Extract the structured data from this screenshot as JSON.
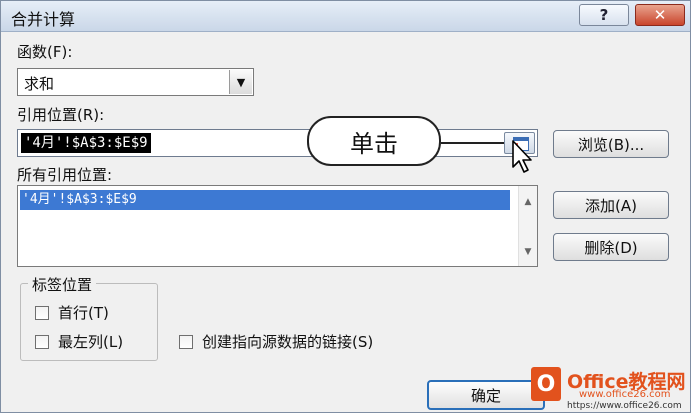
{
  "window": {
    "title": "合并计算",
    "help_label": "?",
    "close_label": "✕"
  },
  "function": {
    "label": "函数(F):",
    "selected": "求和"
  },
  "reference": {
    "label": "引用位置(R):",
    "value": "'4月'!$A$3:$E$9",
    "browse_label": "浏览(B)..."
  },
  "callout": {
    "text": "单击"
  },
  "all_references": {
    "label": "所有引用位置:",
    "items": [
      "'4月'!$A$3:$E$9"
    ],
    "add_label": "添加(A)",
    "delete_label": "删除(D)"
  },
  "label_position": {
    "legend": "标签位置",
    "top_row_label": "首行(T)",
    "top_row_checked": false,
    "left_column_label": "最左列(L)",
    "left_column_checked": false
  },
  "link": {
    "label": "创建指向源数据的链接(S)",
    "checked": false
  },
  "buttons": {
    "ok_label": "确定"
  },
  "watermark": {
    "title": "Office教程网",
    "url1": "www.office26.com",
    "url2": "https://www.office26.com"
  },
  "colors": {
    "selection": "#3d79d3",
    "title_bar": "#d5e0ee",
    "close_button": "#c9452c",
    "watermark": "#e2521d"
  }
}
